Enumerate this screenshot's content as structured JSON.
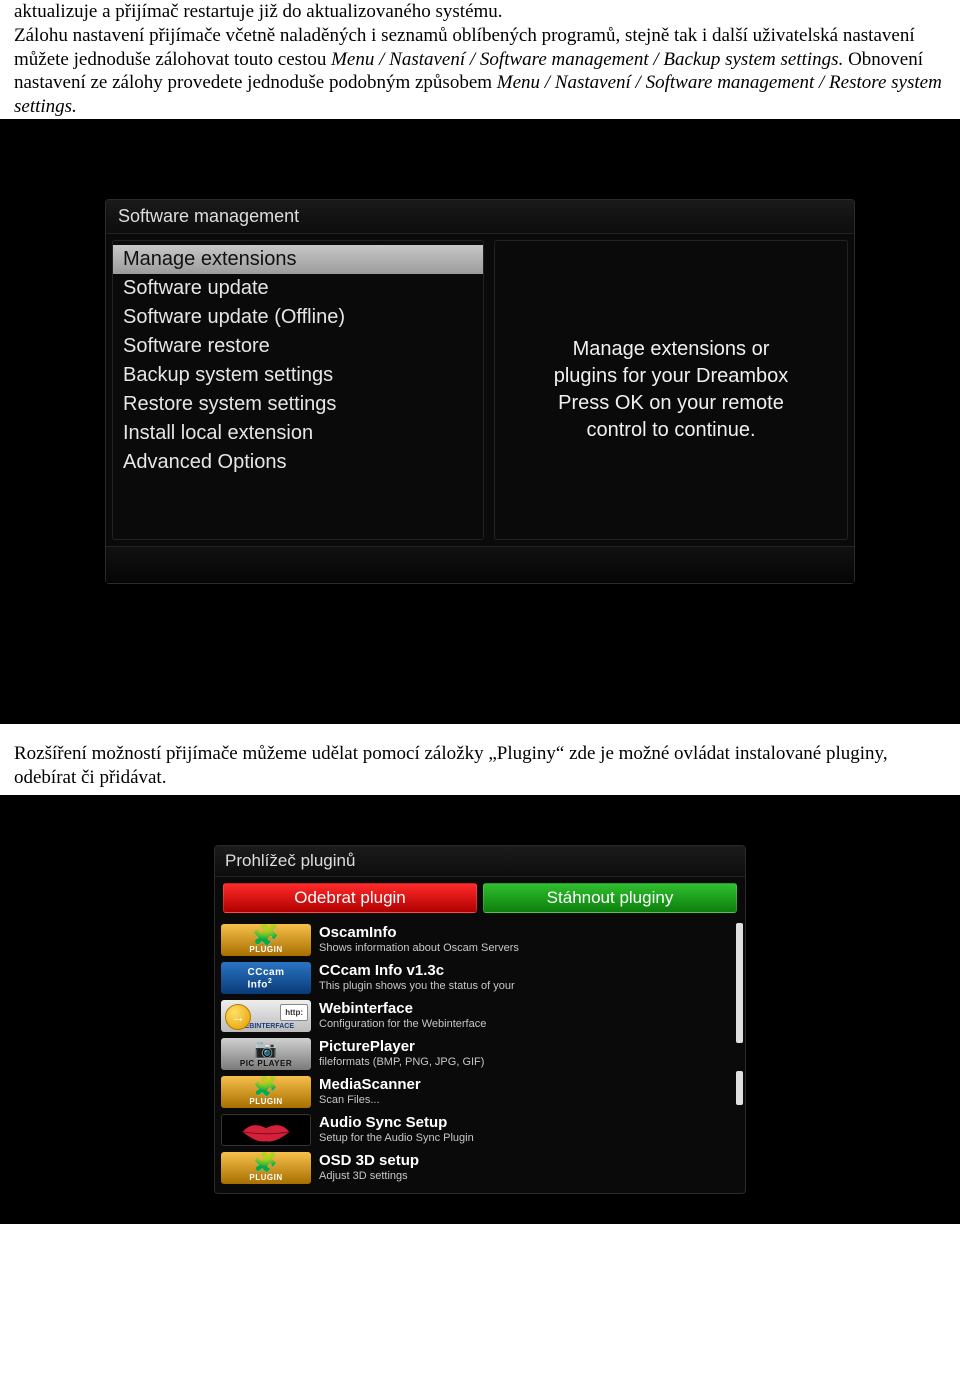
{
  "doc": {
    "para1a": "aktualizuje a přijímač restartuje již do aktualizovaného systému.",
    "para1b": "Zálohu nastavení přijímače včetně naladěných i seznamů oblíbených programů, stejně tak i další uživatelská nastavení můžete jednoduše zálohovat touto cestou ",
    "para1b_italic1": "Menu / Nastavení / Software management / Backup system settings.",
    "para1b_mid": " Obnovení nastavení ze zálohy provedete jednoduše podobným způsobem ",
    "para1b_italic2": "Menu / Nastavení / Software management / Restore system settings.",
    "para2": "Rozšíření možností přijímače můžeme udělat pomocí záložky „Pluginy“ zde je možné ovládat instalované pluginy, odebírat či přidávat."
  },
  "sm": {
    "title": "Software management",
    "items": [
      "Manage extensions",
      "Software update",
      "Software update (Offline)",
      "Software restore",
      "Backup system settings",
      "Restore system settings",
      "Install local extension",
      "Advanced Options"
    ],
    "desc_l1": "Manage extensions or",
    "desc_l2": "plugins for your Dreambox",
    "desc_l3": "Press OK on your remote",
    "desc_l4": "control to continue."
  },
  "pb": {
    "title": "Prohlížeč pluginů",
    "btn_remove": "Odebrat plugin",
    "btn_download": "Stáhnout pluginy",
    "rows": [
      {
        "name": "OscamInfo",
        "sub": "Shows information about Oscam Servers",
        "iconLabel": "PLUGIN"
      },
      {
        "name": "CCcam Info v1.3c",
        "sub": "This plugin shows you the status of your",
        "iconLabel": ""
      },
      {
        "name": "Webinterface",
        "sub": "Configuration for the Webinterface",
        "iconLabel": "WEBINTERFACE"
      },
      {
        "name": "PicturePlayer",
        "sub": "fileformats (BMP, PNG, JPG, GIF)",
        "iconLabel": "PIC PLAYER"
      },
      {
        "name": "MediaScanner",
        "sub": "Scan Files...",
        "iconLabel": "PLUGIN"
      },
      {
        "name": "Audio Sync Setup",
        "sub": "Setup for the Audio Sync Plugin",
        "iconLabel": ""
      },
      {
        "name": "OSD 3D setup",
        "sub": "Adjust 3D settings",
        "iconLabel": "PLUGIN"
      }
    ],
    "cccam_text": "CCcam",
    "cccam_info": "Info",
    "web_http": "http:",
    "web_arrow": "→"
  }
}
